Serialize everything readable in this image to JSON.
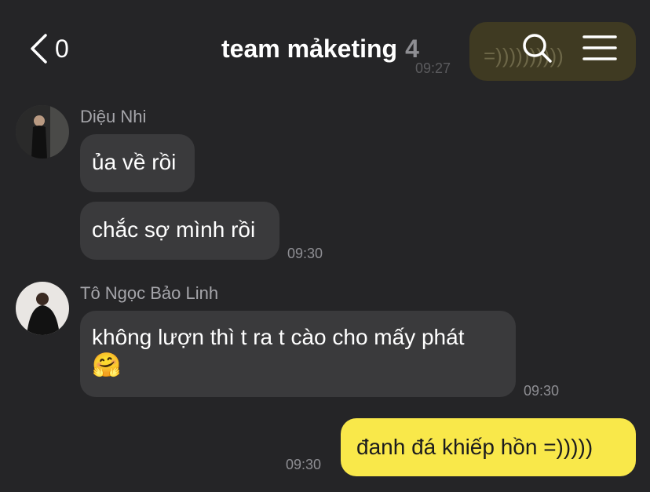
{
  "header": {
    "back_count": "0",
    "title": "team mảketing",
    "member_count": "4"
  },
  "background_preview": {
    "text": "=))))))))))",
    "time": "09:27"
  },
  "messages": [
    {
      "sender": "Diệu Nhi",
      "bubbles": [
        "ủa về rồi",
        "chắc sợ mình rồi"
      ],
      "time": "09:30"
    },
    {
      "sender": "Tô Ngọc Bảo Linh",
      "text": "không lượn thì t ra t cào cho mấy phát",
      "emoji": "🤗",
      "time": "09:30"
    },
    {
      "sender": "me",
      "text": "đanh đá khiếp hồn =)))))",
      "time": "09:30"
    }
  ],
  "colors": {
    "background": "#252527",
    "bubble_other": "#3a3a3c",
    "bubble_me": "#f9e84a",
    "timestamp": "#8e8e93"
  },
  "icons": {
    "back": "chevron-left-icon",
    "search": "search-icon",
    "menu": "hamburger-menu-icon"
  }
}
